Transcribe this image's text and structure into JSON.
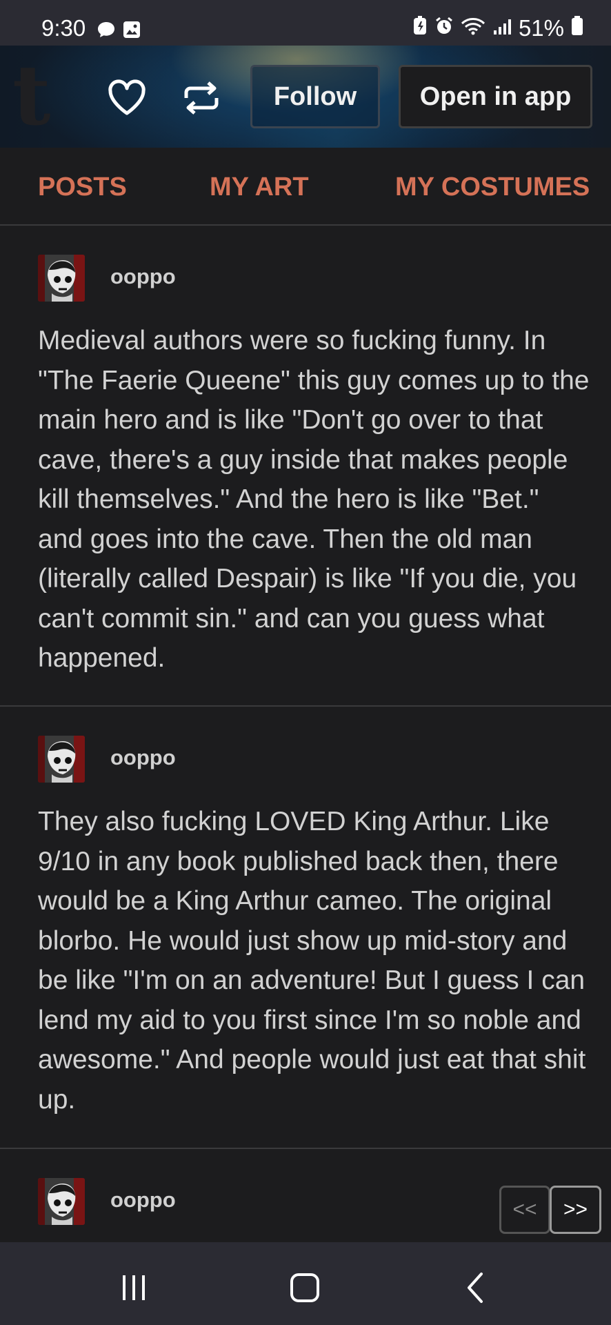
{
  "status_bar": {
    "time": "9:30",
    "battery_percent": "51%",
    "icons": [
      "chat-bubble-icon",
      "image-icon",
      "battery-saver-icon",
      "alarm-icon",
      "wifi-icon",
      "signal-icon",
      "battery-icon"
    ]
  },
  "header": {
    "logo": "t",
    "follow_label": "Follow",
    "open_in_app_label": "Open in app"
  },
  "nav": {
    "items": [
      {
        "label": "POSTS"
      },
      {
        "label": "MY ART"
      },
      {
        "label": "MY COSTUMES"
      }
    ]
  },
  "posts": [
    {
      "username": "ooppo",
      "text": "Medieval authors were so fucking funny. In \"The Faerie Queene\" this guy comes up to the main hero and is like \"Don't go over to that cave, there's a guy inside that makes people kill themselves.\" And the hero is like \"Bet.\" and goes into the cave. Then the old man (literally called Despair) is like \"If you die, you can't commit sin.\" and can you guess what happened."
    },
    {
      "username": "ooppo",
      "text": "They also fucking LOVED King Arthur. Like 9/10 in any book published back then, there would be a King Arthur cameo. The original blorbo. He would just show up mid-story and be like \"I'm on an adventure! But I guess I can lend my aid to you first since I'm so noble and awesome.\" And people would just eat that shit up."
    },
    {
      "username": "ooppo",
      "text": ""
    }
  ],
  "pager": {
    "prev_label": "<<",
    "next_label": ">>"
  },
  "colors": {
    "accent_nav": "#d57257",
    "background": "#1c1c1e",
    "system_bar": "#2b2b33"
  }
}
